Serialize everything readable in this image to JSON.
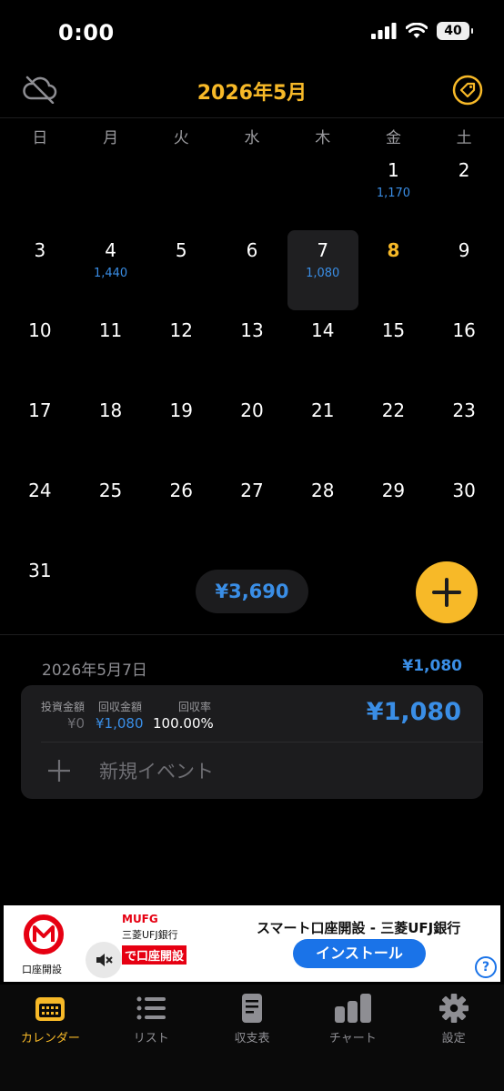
{
  "status": {
    "time": "0:00",
    "battery": "40"
  },
  "header": {
    "title": "2026年5月",
    "left_icon": "cloud-off-icon",
    "right_icon": "tag-icon"
  },
  "weekdays": [
    "日",
    "月",
    "火",
    "水",
    "木",
    "金",
    "土"
  ],
  "calendar": {
    "rows": [
      [
        {
          "d": ""
        },
        {
          "d": ""
        },
        {
          "d": ""
        },
        {
          "d": ""
        },
        {
          "d": ""
        },
        {
          "d": "1",
          "amt": "1,170"
        },
        {
          "d": "2"
        }
      ],
      [
        {
          "d": "3"
        },
        {
          "d": "4",
          "amt": "1,440"
        },
        {
          "d": "5"
        },
        {
          "d": "6"
        },
        {
          "d": "7",
          "amt": "1,080",
          "selected": true
        },
        {
          "d": "8",
          "today": true
        },
        {
          "d": "9"
        }
      ],
      [
        {
          "d": "10"
        },
        {
          "d": "11"
        },
        {
          "d": "12"
        },
        {
          "d": "13"
        },
        {
          "d": "14"
        },
        {
          "d": "15"
        },
        {
          "d": "16"
        }
      ],
      [
        {
          "d": "17"
        },
        {
          "d": "18"
        },
        {
          "d": "19"
        },
        {
          "d": "20"
        },
        {
          "d": "21"
        },
        {
          "d": "22"
        },
        {
          "d": "23"
        }
      ],
      [
        {
          "d": "24"
        },
        {
          "d": "25"
        },
        {
          "d": "26"
        },
        {
          "d": "27"
        },
        {
          "d": "28"
        },
        {
          "d": "29"
        },
        {
          "d": "30"
        }
      ],
      [
        {
          "d": "31"
        },
        {
          "d": ""
        },
        {
          "d": ""
        },
        {
          "d": ""
        },
        {
          "d": ""
        },
        {
          "d": ""
        },
        {
          "d": ""
        }
      ]
    ]
  },
  "month_total": "¥3,690",
  "detail": {
    "date": "2026年5月7日",
    "total": "¥1,080",
    "invest_label": "投資金額",
    "invest_value": "¥0",
    "return_label": "回収金額",
    "return_value": "¥1,080",
    "rate_label": "回収率",
    "rate_value": "100.00%",
    "amount": "¥1,080",
    "new_event": "新規イベント"
  },
  "ad": {
    "title": "スマート口座開設 - 三菱UFJ銀行",
    "install": "インストール",
    "logo_caption": "口座開設",
    "mufg": "MUFG",
    "bank": "三菱UFJ銀行",
    "banner": "で口座開設",
    "help": "?"
  },
  "tabs": [
    {
      "label": "カレンダー",
      "icon": "calendar-icon"
    },
    {
      "label": "リスト",
      "icon": "list-icon"
    },
    {
      "label": "収支表",
      "icon": "document-icon"
    },
    {
      "label": "チャート",
      "icon": "bar-chart-icon"
    },
    {
      "label": "設定",
      "icon": "gear-icon"
    }
  ],
  "colors": {
    "accent": "#f7b928",
    "blue": "#3a8ee6"
  }
}
